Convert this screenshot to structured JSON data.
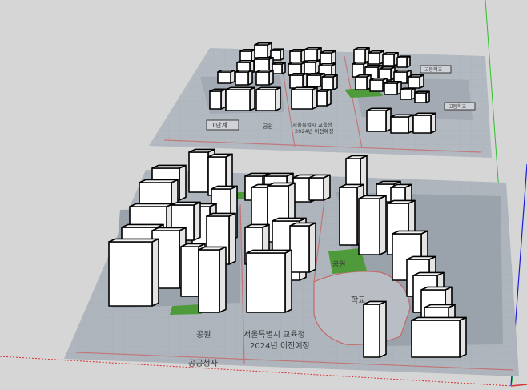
{
  "colors": {
    "background": "#d6d6d6",
    "plan_gray": "#aab1b9",
    "plan_dark": "#969ea8",
    "park_green": "#4f9a3a",
    "road_red": "#c46a6a",
    "building_front": "#ffffff",
    "building_side": "#e4e4e4",
    "building_top": "#f4f4f4",
    "axis_green": "#2dbf2d",
    "axis_blue": "#1c1cd8",
    "axis_red": "#d83030"
  },
  "scene": {
    "top_plan": {
      "labels": {
        "box_left": "1단계",
        "park": "공원",
        "office_line1": "서울특별시 교육청",
        "office_line2": "2024년 이전예정",
        "box_right_upper": "고등학교",
        "box_right_lower": "고등학교"
      }
    },
    "bottom_plan": {
      "labels": {
        "park_left": "공원",
        "office_line1": "서울특별시 교육청",
        "office_line2": "2024년 이전예정",
        "public_office": "공공청사",
        "park_center": "공원",
        "school": "학교"
      }
    }
  }
}
